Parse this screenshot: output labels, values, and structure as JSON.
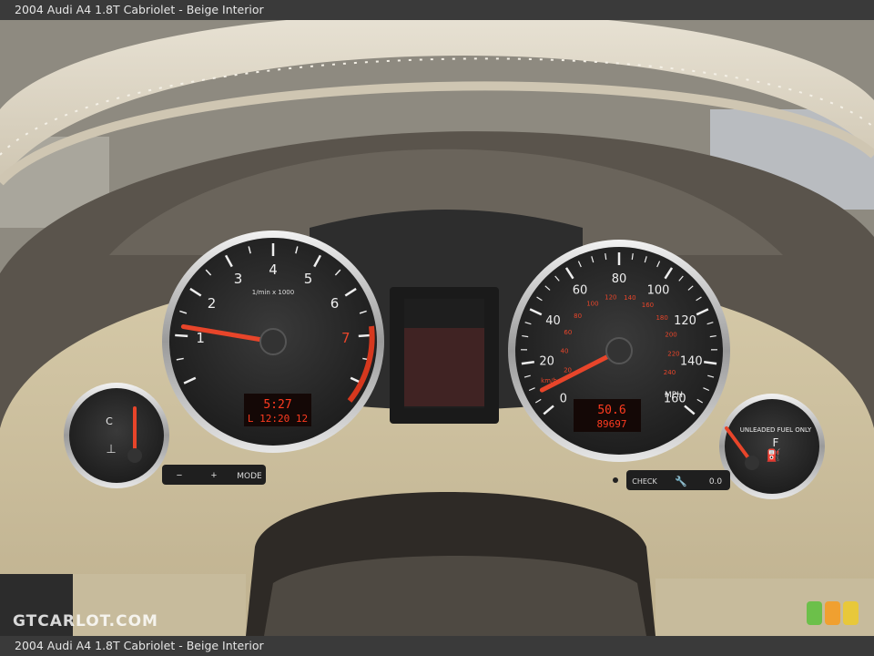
{
  "caption_top": "2004 Audi A4 1.8T Cabriolet - Beige Interior",
  "caption_bottom": "2004 Audi A4 1.8T Cabriolet - Beige Interior",
  "watermark": "GTCARLOT.COM",
  "colors": {
    "dash_beige": "#c9bc9c",
    "gauge_face": "#262626",
    "needle": "#e8452a",
    "lcd_red": "#ff3b20",
    "chrome": "#d8d8d8",
    "rating_green": "#6cc04a",
    "rating_orange": "#f0a030",
    "rating_yellow": "#e8c83a"
  },
  "tachometer": {
    "ticks": [
      "1",
      "2",
      "3",
      "4",
      "5",
      "6",
      "7"
    ],
    "unit": "1/min x 1000",
    "reading": 1.2,
    "lcd_line1": "5:27",
    "lcd_line2": "L 12:20 12"
  },
  "speedometer": {
    "mph_ticks": [
      "0",
      "20",
      "40",
      "60",
      "80",
      "100",
      "120",
      "140",
      "160"
    ],
    "kmh_ticks": [
      "20",
      "40",
      "60",
      "80",
      "100",
      "120",
      "140",
      "160",
      "180",
      "200",
      "220",
      "240"
    ],
    "unit_mph": "MPH",
    "unit_kmh": "km/h",
    "reading_mph": 8,
    "lcd_line1": "50.6",
    "lcd_line2": "89697"
  },
  "temp_gauge": {
    "low_label": "C",
    "reading": 0.5
  },
  "fuel_gauge": {
    "full_label": "F",
    "label": "UNLEADED FUEL ONLY",
    "reading": 0.1
  },
  "buttons": {
    "minus": "−",
    "plus": "+",
    "mode": "MODE",
    "check": "CHECK",
    "service_icon": "wrench-icon",
    "odo": "0.0"
  }
}
